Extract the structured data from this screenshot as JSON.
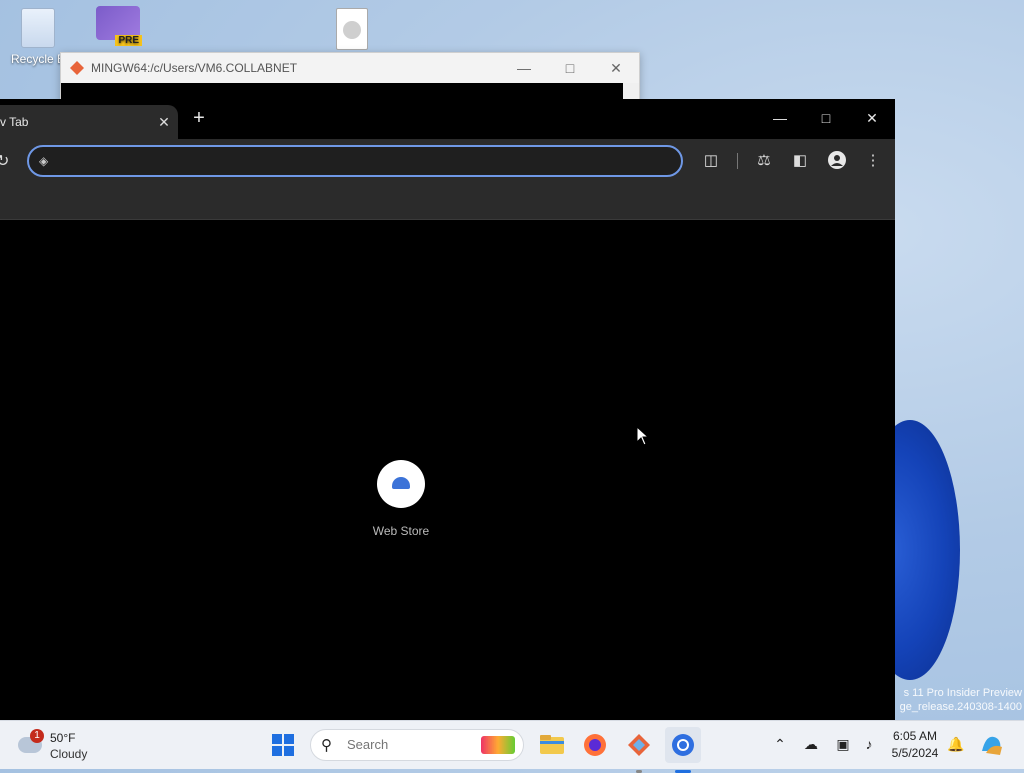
{
  "desktop": {
    "icons": [
      {
        "label": "Recycle B"
      },
      {
        "label": "PRE"
      }
    ],
    "watermark_line1": "s 11 Pro Insider Preview",
    "watermark_line2": "ge_release.240308-1400"
  },
  "terminal": {
    "title": "MINGW64:/c/Users/VM6.COLLABNET"
  },
  "browser": {
    "tab_label": "Tab",
    "omnibox_value": "",
    "shortcut_label": "Web Store",
    "accent": "#6f98e6"
  },
  "taskbar": {
    "weather_badge": "1",
    "weather_temp": "50°F",
    "weather_cond": "Cloudy",
    "search_placeholder": "Search",
    "time": "6:05 AM",
    "date": "5/5/2024"
  }
}
